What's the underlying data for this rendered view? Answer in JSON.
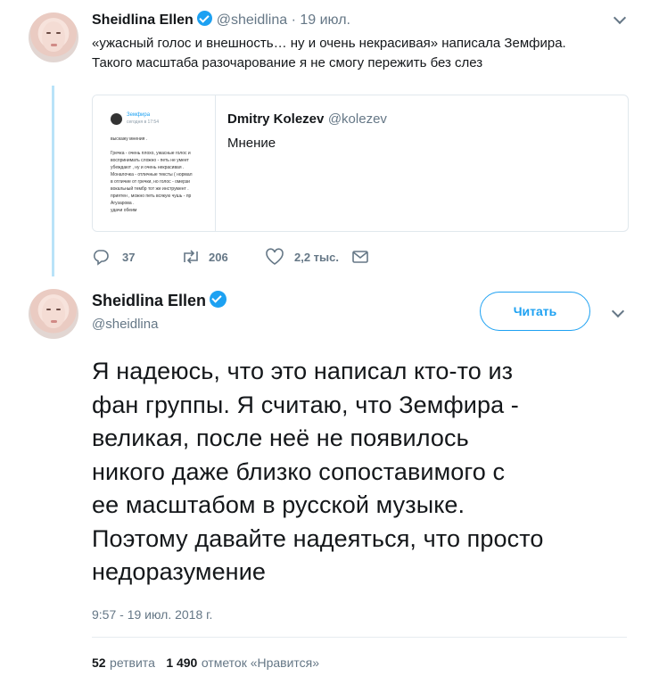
{
  "tweet1": {
    "name": "Sheidlina Ellen",
    "handle": "@sheidlina",
    "separator": "·",
    "date": "19 июл.",
    "text_line1": "«ужасный голос и внешность… ну и очень некрасивая» написала Земфира.",
    "text_line2": "Такого масштаба разочарование я не смогу пережить без слез",
    "quote": {
      "name": "Dmitry Kolezev",
      "handle": "@kolezev",
      "text": "Мнение",
      "screenshot": {
        "name": "Земфира",
        "date": "сегодня в 17:54",
        "text": "выскажу мнения .\n\nГречка - очень плохо, ужасные голос и\nвоспринимать сложно - петь не умеет\nубеждают , ну и очень некрасивая .\nМоналочка - отличные тексты ( нормал\nв отличие от гречки, но голос - омерзи\nвокальный тембр тот же инструмент .\nприятен , можно петь всякую чушь - пр\nАгузарова .\nудачи обеим"
      }
    },
    "actions": {
      "replies": "37",
      "retweets": "206",
      "likes": "2,2 тыс."
    }
  },
  "tweet2": {
    "name": "Sheidlina Ellen",
    "handle": "@sheidlina",
    "follow_label": "Читать",
    "text_lines": [
      "Я надеюсь, что это написал кто-то из",
      "фан группы. Я считаю, что Земфира -",
      "великая, после неё не появилось",
      "никого даже близко сопоставимого с",
      "ее масштабом в русской музыке.",
      "Поэтому давайте надеяться, что просто",
      "недоразумение"
    ],
    "timestamp": "9:57 - 19 июл. 2018 г.",
    "retweets_count": "52",
    "retweets_label": "ретвита",
    "likes_count": "1 490",
    "likes_label": "отметок «Нравится»"
  },
  "icons": {
    "verified": "verified-badge",
    "reply": "reply-icon",
    "retweet": "retweet-icon",
    "like": "heart-icon",
    "dm": "envelope-icon",
    "caret": "chevron-down-icon"
  },
  "colors": {
    "accent": "#1da1f2",
    "muted": "#657786",
    "thread_line": "#b9e3f8"
  }
}
